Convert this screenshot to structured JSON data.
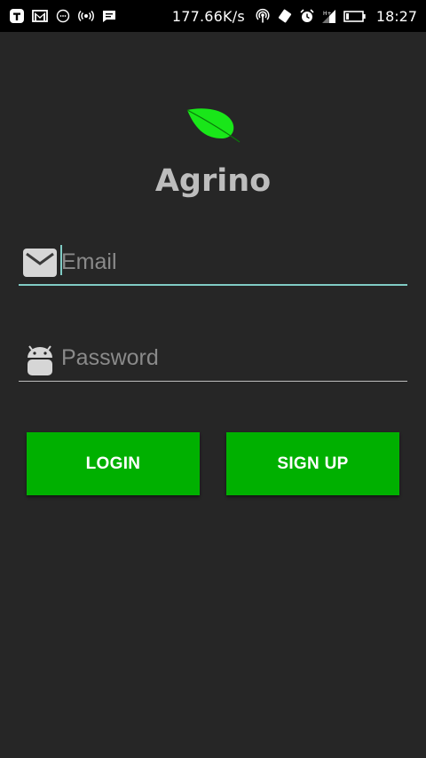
{
  "status_bar": {
    "network_speed": "177.66K/s",
    "time": "18:27",
    "icons": [
      "t-app-icon",
      "gmail-icon",
      "chat-bubble-icon",
      "broadcast-icon",
      "message-icon",
      "hotspot-icon",
      "vibrate-icon",
      "alarm-icon",
      "signal-icon",
      "battery-icon"
    ]
  },
  "app": {
    "title": "Agrino",
    "logo": "leaf-icon",
    "accent_color": "#00b000",
    "leaf_color": "#19e619",
    "underline_color": "#80cbc4"
  },
  "login_form": {
    "email": {
      "icon": "mail-icon",
      "value": "",
      "placeholder": "Email"
    },
    "password": {
      "icon": "android-icon",
      "value": "",
      "placeholder": "Password"
    },
    "login_label": "LOGIN",
    "signup_label": "SIGN UP"
  }
}
